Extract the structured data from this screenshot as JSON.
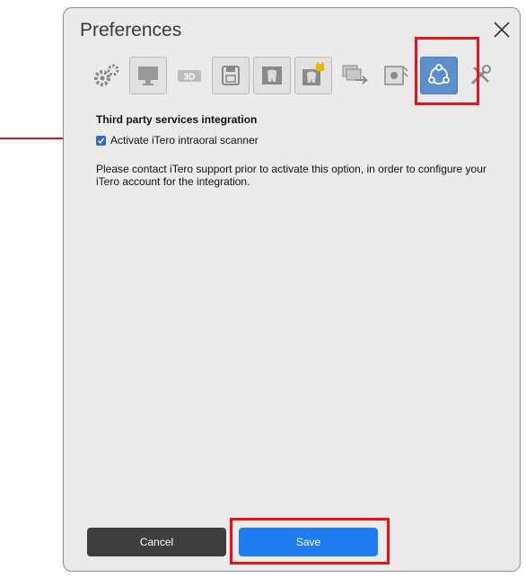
{
  "dialog": {
    "title": "Preferences",
    "close_icon": "close-icon"
  },
  "toolbar": {
    "icons": [
      {
        "name": "gears-icon"
      },
      {
        "name": "monitor-icon"
      },
      {
        "name": "3d-icon",
        "label": "3D"
      },
      {
        "name": "save-disk-icon"
      },
      {
        "name": "tooth-icon"
      },
      {
        "name": "tooth-lock-icon"
      },
      {
        "name": "export-icon"
      },
      {
        "name": "scan-icon"
      },
      {
        "name": "share-integration-icon",
        "active": true
      },
      {
        "name": "tools-icon"
      }
    ]
  },
  "section": {
    "title": "Third party services integration",
    "checkbox": {
      "label": "Activate iTero intraoral scanner",
      "checked": true
    },
    "info": "Please contact iTero support prior to activate  this option, in order to configure your iTero account for the integration."
  },
  "buttons": {
    "cancel": "Cancel",
    "save": "Save"
  },
  "colors": {
    "highlight": "#e8141b",
    "save_button": "#1f7cf1",
    "cancel_button": "#3e3e3e",
    "active_tab": "#5c8fcc"
  }
}
